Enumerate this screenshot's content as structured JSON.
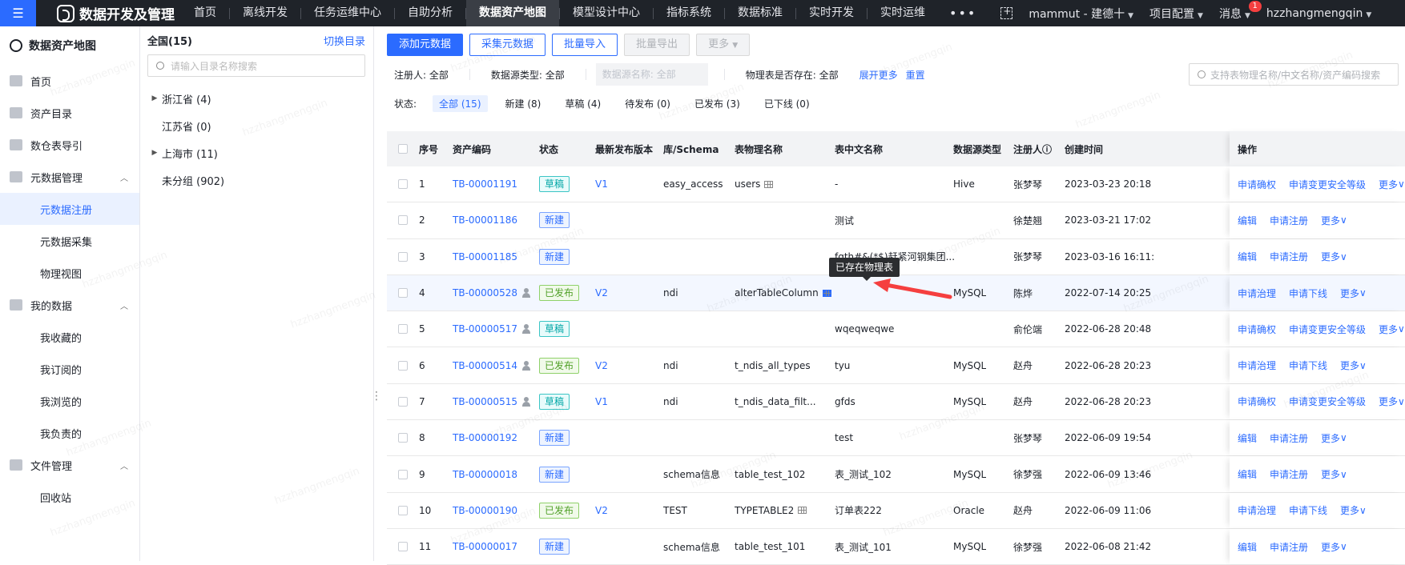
{
  "topbar": {
    "brand": "数据开发及管理",
    "nav": [
      "首页",
      "离线开发",
      "任务运维中心",
      "自助分析",
      "数据资产地图",
      "模型设计中心",
      "指标系统",
      "数据标准",
      "实时开发",
      "实时运维"
    ],
    "nav_active_index": 4,
    "more": "•••",
    "project": "mammut - 建德十",
    "config": "项目配置",
    "messages": "消息",
    "messages_badge": "1",
    "user": "hzzhangmengqin"
  },
  "sidebar": {
    "title": "数据资产地图",
    "items": [
      {
        "label": "首页",
        "icon": "home-icon"
      },
      {
        "label": "资产目录",
        "icon": "catalog-icon"
      },
      {
        "label": "数仓表导引",
        "icon": "warehouse-icon"
      },
      {
        "label": "元数据管理",
        "icon": "metadata-icon",
        "expanded": true,
        "children": [
          "元数据注册",
          "元数据采集",
          "物理视图"
        ]
      },
      {
        "label": "我的数据",
        "icon": "user-icon",
        "expanded": true,
        "children": [
          "我收藏的",
          "我订阅的",
          "我浏览的",
          "我负责的"
        ]
      },
      {
        "label": "文件管理",
        "icon": "folder-icon",
        "expanded": true,
        "children": [
          "回收站"
        ]
      }
    ],
    "active_sub": "元数据注册"
  },
  "tree": {
    "title": "全国(15)",
    "switch_label": "切换目录",
    "search_placeholder": "请输入目录名称搜索",
    "nodes": [
      {
        "label": "浙江省 (4)",
        "expandable": true
      },
      {
        "label": "江苏省 (0)",
        "expandable": false
      },
      {
        "label": "上海市 (11)",
        "expandable": true
      },
      {
        "label": "未分组 (902)",
        "expandable": false
      }
    ]
  },
  "toolbar": {
    "add": "添加元数据",
    "collect": "采集元数据",
    "import": "批量导入",
    "export": "批量导出",
    "more": "更多"
  },
  "filters": {
    "registrant": "注册人: 全部",
    "source_type": "数据源类型: 全部",
    "source_name": "数据源名称: 全部",
    "physical_exists": "物理表是否存在: 全部",
    "expand": "展开更多",
    "reset": "重置",
    "search_placeholder": "支持表物理名称/中文名称/资产编码搜索"
  },
  "status": {
    "label": "状态:",
    "tabs": [
      "全部 (15)",
      "新建 (8)",
      "草稿 (4)",
      "待发布 (0)",
      "已发布 (3)",
      "已下线 (0)"
    ],
    "active_index": 0
  },
  "table": {
    "columns": [
      "序号",
      "资产编码",
      "状态",
      "最新发布版本",
      "库/Schema",
      "表物理名称",
      "表中文名称",
      "数据源类型",
      "注册人",
      "创建时间",
      "操作"
    ],
    "rows": [
      {
        "no": "1",
        "code": "TB-00001191",
        "user_icon": false,
        "status": "草稿",
        "status_type": "draft",
        "version": "V1",
        "schema": "easy_access",
        "physical": "users",
        "phys_icon": "grey",
        "cn": "-",
        "src": "Hive",
        "reg": "张梦琴",
        "time": "2023-03-23 20:18",
        "ops": [
          "申请确权",
          "申请变更安全等级",
          "更多"
        ]
      },
      {
        "no": "2",
        "code": "TB-00001186",
        "user_icon": false,
        "status": "新建",
        "status_type": "new",
        "version": "",
        "schema": "",
        "physical": "",
        "phys_icon": "",
        "cn": "测试",
        "src": "",
        "reg": "徐楚翘",
        "time": "2023-03-21 17:02",
        "ops": [
          "编辑",
          "申请注册",
          "更多"
        ]
      },
      {
        "no": "3",
        "code": "TB-00001185",
        "user_icon": false,
        "status": "新建",
        "status_type": "new",
        "version": "",
        "schema": "",
        "physical": "",
        "phys_icon": "",
        "cn": "fgth#&(*$)赶紧河钢集团...",
        "src": "",
        "reg": "张梦琴",
        "time": "2023-03-16 16:11:",
        "ops": [
          "编辑",
          "申请注册",
          "更多"
        ]
      },
      {
        "no": "4",
        "code": "TB-00000528",
        "user_icon": true,
        "status": "已发布",
        "status_type": "pub",
        "version": "V2",
        "schema": "ndi",
        "physical": "alterTableColumn",
        "phys_icon": "blue",
        "cn": "",
        "src": "MySQL",
        "reg": "陈烨",
        "time": "2022-07-14 20:25",
        "ops": [
          "申请治理",
          "申请下线",
          "更多"
        ]
      },
      {
        "no": "5",
        "code": "TB-00000517",
        "user_icon": true,
        "status": "草稿",
        "status_type": "draft",
        "version": "",
        "schema": "",
        "physical": "",
        "phys_icon": "",
        "cn": "wqeqweqwe",
        "src": "",
        "reg": "俞伦端",
        "time": "2022-06-28 20:48",
        "ops": [
          "申请确权",
          "申请变更安全等级",
          "更多"
        ]
      },
      {
        "no": "6",
        "code": "TB-00000514",
        "user_icon": true,
        "status": "已发布",
        "status_type": "pub",
        "version": "V2",
        "schema": "ndi",
        "physical": "t_ndis_all_types",
        "phys_icon": "",
        "cn": "tyu",
        "src": "MySQL",
        "reg": "赵舟",
        "time": "2022-06-28 20:23",
        "ops": [
          "申请治理",
          "申请下线",
          "更多"
        ]
      },
      {
        "no": "7",
        "code": "TB-00000515",
        "user_icon": true,
        "status": "草稿",
        "status_type": "draft",
        "version": "V1",
        "schema": "ndi",
        "physical": "t_ndis_data_filt...",
        "phys_icon": "",
        "cn": "gfds",
        "src": "MySQL",
        "reg": "赵舟",
        "time": "2022-06-28 20:23",
        "ops": [
          "申请确权",
          "申请变更安全等级",
          "更多"
        ]
      },
      {
        "no": "8",
        "code": "TB-00000192",
        "user_icon": false,
        "status": "新建",
        "status_type": "new",
        "version": "",
        "schema": "",
        "physical": "",
        "phys_icon": "",
        "cn": "test",
        "src": "",
        "reg": "张梦琴",
        "time": "2022-06-09 19:54",
        "ops": [
          "编辑",
          "申请注册",
          "更多"
        ]
      },
      {
        "no": "9",
        "code": "TB-00000018",
        "user_icon": false,
        "status": "新建",
        "status_type": "new",
        "version": "",
        "schema": "schema信息",
        "physical": "table_test_102",
        "phys_icon": "",
        "cn": "表_测试_102",
        "src": "MySQL",
        "reg": "徐梦强",
        "time": "2022-06-09 13:46",
        "ops": [
          "编辑",
          "申请注册",
          "更多"
        ]
      },
      {
        "no": "10",
        "code": "TB-00000190",
        "user_icon": false,
        "status": "已发布",
        "status_type": "pub",
        "version": "V2",
        "schema": "TEST",
        "physical": "TYPETABLE2",
        "phys_icon": "grey",
        "cn": "订单表222",
        "src": "Oracle",
        "reg": "赵舟",
        "time": "2022-06-09 11:06",
        "ops": [
          "申请治理",
          "申请下线",
          "更多"
        ]
      },
      {
        "no": "11",
        "code": "TB-00000017",
        "user_icon": false,
        "status": "新建",
        "status_type": "new",
        "version": "",
        "schema": "schema信息",
        "physical": "table_test_101",
        "phys_icon": "",
        "cn": "表_测试_101",
        "src": "MySQL",
        "reg": "徐梦强",
        "time": "2022-06-08 21:42",
        "ops": [
          "编辑",
          "申请注册",
          "更多"
        ]
      }
    ]
  },
  "tooltip": "已存在物理表",
  "watermark": "hzzhangmengqin",
  "colors": {
    "accent": "#2b6bff",
    "topbar": "#1f2329",
    "arrow": "#f53f3f"
  }
}
